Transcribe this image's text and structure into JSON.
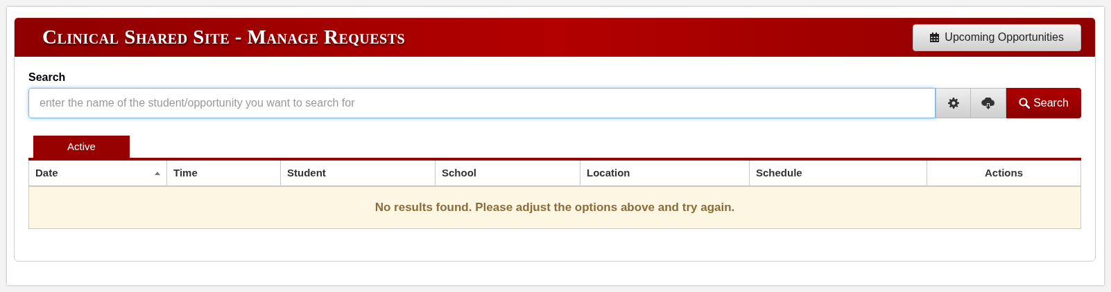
{
  "header": {
    "title": "Clinical Shared Site - Manage Requests",
    "button": "Upcoming Opportunities"
  },
  "search": {
    "label": "Search",
    "placeholder": "enter the name of the student/opportunity you want to search for",
    "button": "Search"
  },
  "tabs": [
    {
      "label": "Active",
      "selected": true
    }
  ],
  "table": {
    "columns": [
      {
        "label": "Date",
        "sorted": true
      },
      {
        "label": "Time",
        "sorted": false
      },
      {
        "label": "Student",
        "sorted": false
      },
      {
        "label": "School",
        "sorted": false
      },
      {
        "label": "Location",
        "sorted": false
      },
      {
        "label": "Schedule",
        "sorted": false
      },
      {
        "label": "Actions",
        "sorted": false
      }
    ],
    "empty_message": "No results found. Please adjust the options above and try again."
  }
}
